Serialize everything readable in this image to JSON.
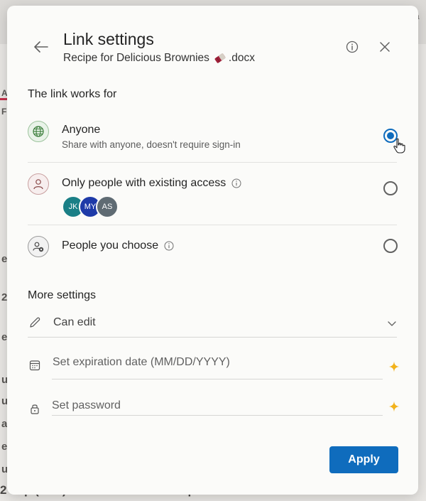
{
  "background": {
    "fragments": [
      "A",
      "F",
      "e",
      "2",
      "e",
      "u",
      "u",
      "a",
      "e",
      "u"
    ],
    "bottom_text": "2 cup (4 oz) unsweetened cocoa powder",
    "right_text": "ca"
  },
  "dialog": {
    "title": "Link settings",
    "file_name": "Recipe for Delicious Brownies",
    "file_ext": ".docx"
  },
  "link_section": {
    "heading": "The link works for",
    "options": [
      {
        "label": "Anyone",
        "description": "Share with anyone, doesn't require sign-in",
        "selected": true,
        "icon": "globe-icon"
      },
      {
        "label": "Only people with existing access",
        "selected": false,
        "icon": "person-icon"
      },
      {
        "label": "People you choose",
        "selected": false,
        "icon": "people-settings-icon"
      }
    ],
    "avatars": [
      {
        "initials": "JK",
        "color": "#1a7f86"
      },
      {
        "initials": "MY",
        "color": "#1e3aa8"
      },
      {
        "initials": "AS",
        "color": "#5f6b73"
      }
    ]
  },
  "more_settings": {
    "heading": "More settings",
    "permission": "Can edit",
    "expiration_placeholder": "Set expiration date (MM/DD/YYYY)",
    "password_placeholder": "Set password"
  },
  "buttons": {
    "apply": "Apply"
  },
  "colors": {
    "accent": "#0f6cbd",
    "premium": "#f2b21b"
  }
}
